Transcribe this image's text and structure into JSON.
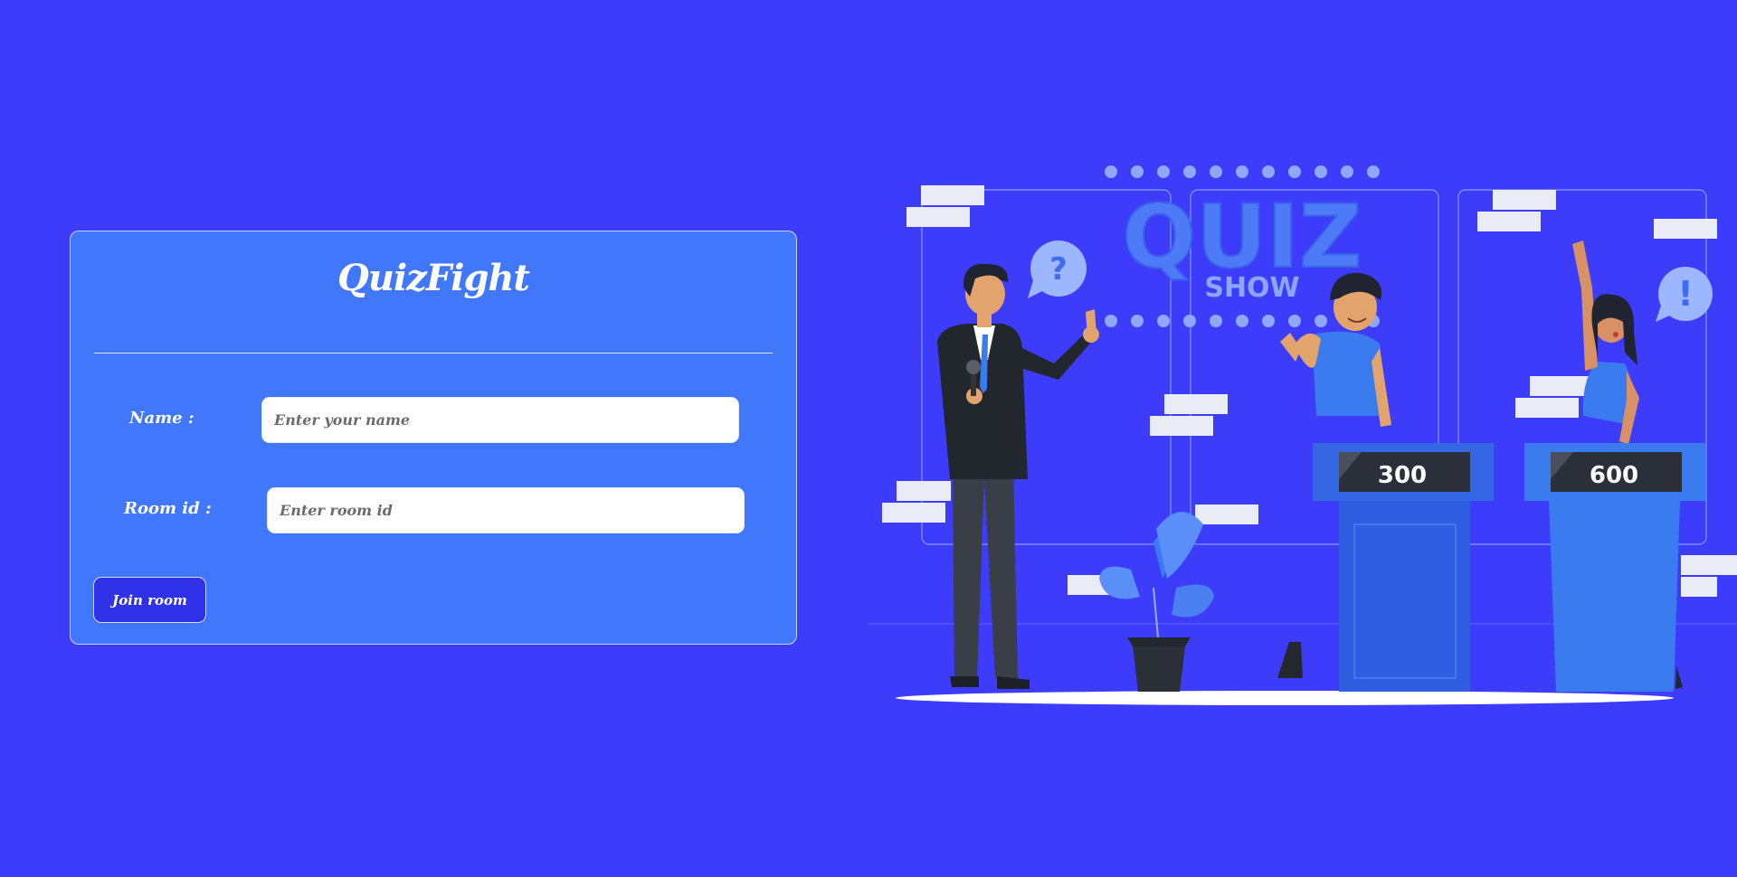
{
  "app": {
    "title": "QuizFight"
  },
  "form": {
    "name_label": "Name :",
    "name_placeholder": "Enter your name",
    "name_value": "",
    "room_label": "Room id :",
    "room_placeholder": "Enter room id",
    "room_value": "",
    "join_label": "Join room"
  },
  "illustration": {
    "sign_main": "QUIZ",
    "sign_sub": "SHOW",
    "question_mark": "?",
    "exclamation_mark": "!",
    "podium_left_score": "300",
    "podium_right_score": "600"
  },
  "colors": {
    "background": "#3c3cfa",
    "card": "#4178fb",
    "button": "#3131e8",
    "podium_blue": "#2f5fe0",
    "score_panel": "#2a2f3a"
  }
}
